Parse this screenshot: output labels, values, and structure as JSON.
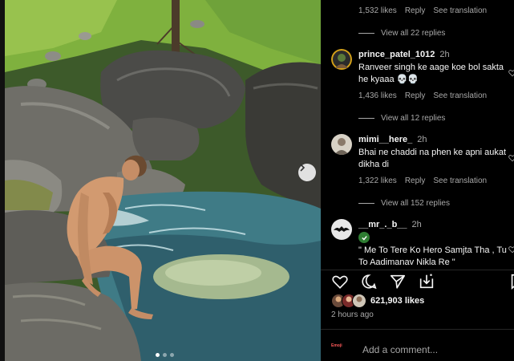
{
  "photo": {
    "slide_count": 3,
    "active_slide": 0
  },
  "comments": [
    {
      "id": "top-partial",
      "meta": {
        "likes": "1,532 likes",
        "reply": "Reply",
        "translate": "See translation"
      },
      "replies": "View all 22 replies"
    },
    {
      "id": "prince",
      "username": "prince_patel_1012",
      "time": "2h",
      "text": "Ranveer singh ke aage koe bol sakta he kyaaa 💀💀",
      "meta": {
        "likes": "1,436 likes",
        "reply": "Reply",
        "translate": "See translation"
      },
      "replies": "View all 12 replies"
    },
    {
      "id": "mimi",
      "username": "mimi__here_",
      "time": "2h",
      "text": "Bhai ne chaddi na phen ke apni aukat dikha di",
      "meta": {
        "likes": "1,322 likes",
        "reply": "Reply",
        "translate": "See translation"
      },
      "replies": "View all 152 replies"
    },
    {
      "id": "mr",
      "username": "__mr_._b__",
      "time": "2h",
      "text": "\" Me To Tere Ko Hero Samjta Tha , Tu To Aadimanav Nikla Re \""
    }
  ],
  "post": {
    "likes": "621,903 likes",
    "timestamp": "2 hours ago"
  },
  "comment_bar": {
    "emoji_label": "Emoji",
    "placeholder": "Add a comment..."
  },
  "colors": {
    "panel_bg": "#000000",
    "muted_text": "#a8a8a8",
    "primary_text": "#f5f5f5",
    "verified": "#2e7d32"
  }
}
